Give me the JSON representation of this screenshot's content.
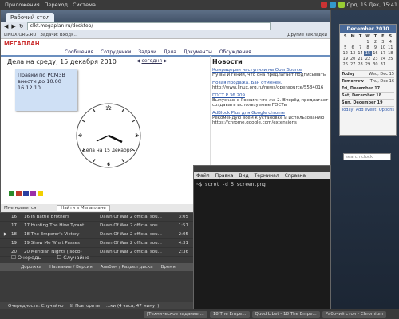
{
  "top_panel": {
    "menu": [
      "Приложения",
      "Переход",
      "Система"
    ],
    "clock": "Срд, 15 Дек, 15:41"
  },
  "browser": {
    "tab_title": "Рабочий стол",
    "url": "clkt.megaplan.ru/desktop/",
    "bookmarks": [
      "LINUX.ORG.RU",
      "Задачи: Входя...",
      "Другие закладки"
    ],
    "nav_items": [
      "Сообщения",
      "Сотрудники",
      "Задачи",
      "Дела",
      "Документы",
      "Обсуждения"
    ],
    "logo": "МЕГАПЛАН",
    "day_header": "Дела на среду, 15 декабря 2010",
    "day_nav": "сегодня",
    "sticky": [
      "Правки по PCM3B",
      "внести до 10.00",
      "16.12.10"
    ],
    "clock_label": "Дела на 15 декабря",
    "clock_numbers": [
      "12",
      "3",
      "6",
      "9"
    ],
    "news": {
      "title": "Новости",
      "items": [
        {
          "title": "Комрадерьи наступили на OpenSource",
          "text": "Ну вы и гении, что она предлагает подписывать"
        },
        {
          "title": "Новая продажа. Бан отменен.",
          "text": "http://www.linux.org.ru/news/opensource/5584016"
        },
        {
          "title": "ГОСТ Р 36.209",
          "text": "Выпускаю в России: что же 2. Вперёд предлагает создавать используемые ГОСТы"
        },
        {
          "title": "AdBlock Plus для Google chrome",
          "text": "Рекомендую всем к установке и использованию https://chrome.google.com/extensions"
        }
      ]
    },
    "status": [
      "Мне нравится",
      "Найти в Мегаплане"
    ],
    "palette": [
      "#2a8a2a",
      "#c0392b",
      "#2c3e9f",
      "#9b2fa8",
      "#f1d000"
    ]
  },
  "player": {
    "tracks": [
      {
        "n": "16",
        "title": "16 In Battle Brothers",
        "album": "Dawn Of War 2 official sou...",
        "time": "3:05"
      },
      {
        "n": "17",
        "title": "17 Hunting The Hive Tyrant",
        "album": "Dawn Of War 2 official sou...",
        "time": "1:51"
      },
      {
        "n": "18",
        "title": "18 The Emperor's Victory",
        "album": "Dawn Of War 2 official sou...",
        "time": "2:05"
      },
      {
        "n": "19",
        "title": "19 Show Me What Passes",
        "album": "Dawn Of War 2 official sou...",
        "time": "4:31"
      },
      {
        "n": "20",
        "title": "20 Meridian Nights (Isoob)",
        "album": "Dawn Of War 2 official sou...",
        "time": "2:36"
      }
    ],
    "tabs": [
      "Очередь",
      "Случайно"
    ],
    "columns": [
      "Дорожка",
      "Название / Версия",
      "Альбом / Раздел диска",
      "Время"
    ],
    "footer": [
      "Очередность: Случайно",
      "Повторить",
      "...ки (4 часа, 47 минут)"
    ]
  },
  "terminal": {
    "menu": [
      "Файл",
      "Правка",
      "Вид",
      "Терминал",
      "Справка"
    ],
    "prompt": "~$ scrot -d 5 screen.png"
  },
  "calendar": {
    "month": "December 2010",
    "weekdays": [
      "S",
      "M",
      "T",
      "W",
      "T",
      "F",
      "S"
    ],
    "days": [
      "",
      "",
      "",
      "1",
      "2",
      "3",
      "4",
      "5",
      "6",
      "7",
      "8",
      "9",
      "10",
      "11",
      "12",
      "13",
      "14",
      "15",
      "16",
      "17",
      "18",
      "19",
      "20",
      "21",
      "22",
      "23",
      "24",
      "25",
      "26",
      "27",
      "28",
      "29",
      "30",
      "31",
      ""
    ],
    "today": "15",
    "agenda": [
      {
        "label": "Today",
        "date": "Wed, Dec 15"
      },
      {
        "label": "Tomorrow",
        "date": "Thu, Dec 16"
      },
      {
        "label": "Fri, December 17",
        "date": ""
      },
      {
        "label": "Sat, December 18",
        "date": ""
      },
      {
        "label": "Sun, December 19",
        "date": ""
      }
    ],
    "links": [
      "Today",
      "Add event",
      "Options"
    ],
    "search": "search clock"
  },
  "taskbar": [
    "[Техническое задание ...",
    "18 The Empe...",
    "Quod Libet - 18 The Empe...",
    "Рабочий стол - Chromium"
  ]
}
